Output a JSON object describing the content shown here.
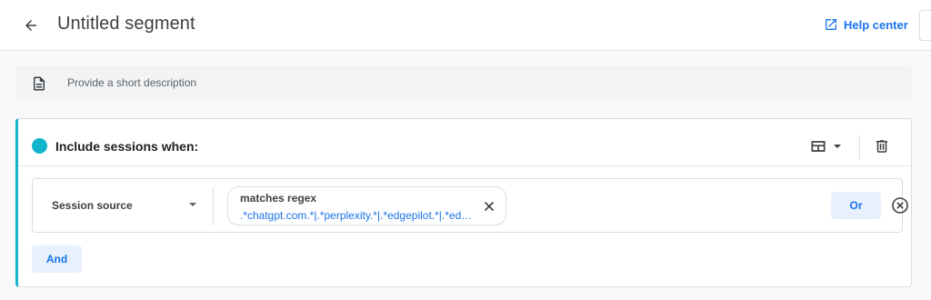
{
  "header": {
    "title": "Untitled segment",
    "help_label": "Help center"
  },
  "description": {
    "placeholder": "Provide a short description"
  },
  "condition_group": {
    "title": "Include sessions when:",
    "accent_color": "#12b5cb",
    "conditions": [
      {
        "dimension": "Session source",
        "operator": "matches regex",
        "value": ".*chatgpt.com.*|.*perplexity.*|.*edgepilot.*|.*edgeservices.*|.*nimble.ai.*|.*copilot.microsoft.com.*|.*openai.*|.*gemini.google.com.*",
        "or_label": "Or"
      }
    ],
    "and_label": "And"
  },
  "icons": {
    "back": "arrow-back-icon",
    "help": "open-in-new-icon",
    "description": "document-icon",
    "scope": "view-scope-icon",
    "delete": "trash-icon",
    "chip_clear": "close-icon",
    "row_remove": "cancel-circle-icon"
  },
  "colors": {
    "accent_blue": "#1a73e8",
    "teal": "#12b5cb",
    "button_bg": "#e8f0fe"
  }
}
